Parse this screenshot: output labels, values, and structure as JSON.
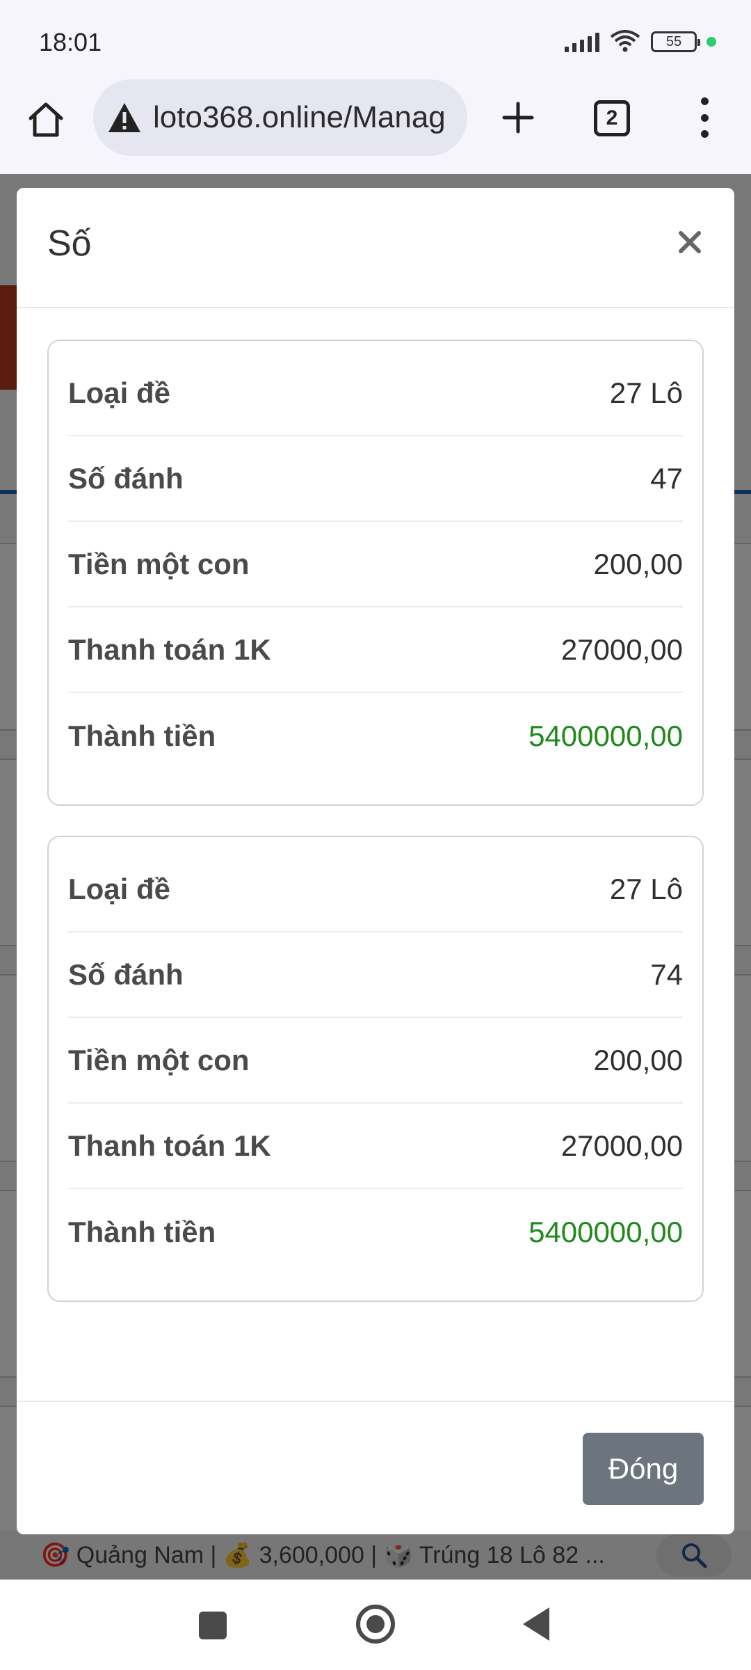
{
  "status_bar": {
    "time": "18:01",
    "battery_level": "55"
  },
  "browser": {
    "url": "loto368.online/Manag",
    "tab_count": "2"
  },
  "ticker": {
    "text": "🎯 Quảng Nam | 💰 3,600,000 | 🎲 Trúng 18 Lô 82 ..."
  },
  "modal": {
    "title": "Số",
    "cards": [
      {
        "rows": [
          {
            "label": "Loại đề",
            "value": "27 Lô"
          },
          {
            "label": "Số đánh",
            "value": "47"
          },
          {
            "label": "Tiền một con",
            "value": "200,00"
          },
          {
            "label": "Thanh toán 1K",
            "value": "27000,00"
          },
          {
            "label": "Thành tiền",
            "value": "5400000,00"
          }
        ]
      },
      {
        "rows": [
          {
            "label": "Loại đề",
            "value": "27 Lô"
          },
          {
            "label": "Số đánh",
            "value": "74"
          },
          {
            "label": "Tiền một con",
            "value": "200,00"
          },
          {
            "label": "Thanh toán 1K",
            "value": "27000,00"
          },
          {
            "label": "Thành tiền",
            "value": "5400000,00"
          }
        ]
      }
    ],
    "close_button_label": "Đóng"
  },
  "colors": {
    "total_value": "#1e8a1e",
    "close_button_bg": "#6c757d",
    "background_banner": "#b5391a",
    "background_accent_line": "#1f5fbf"
  },
  "icons": [
    "home-icon",
    "warning-icon",
    "plus-icon",
    "tabs-icon",
    "menu-icon",
    "close-icon",
    "search-icon",
    "wifi-icon",
    "signal-icon",
    "battery-icon"
  ]
}
